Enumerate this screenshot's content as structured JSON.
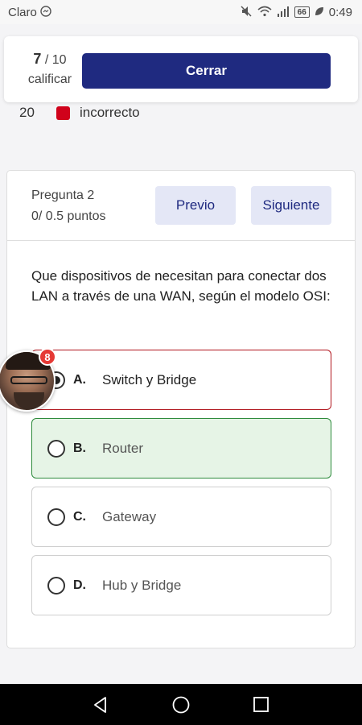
{
  "status_bar": {
    "carrier": "Claro",
    "battery": "66",
    "time": "0:49",
    "icons": [
      "messenger-icon",
      "mute-icon",
      "wifi-icon",
      "signal-icon",
      "battery-icon",
      "leaf-icon"
    ]
  },
  "progress": {
    "current": "7",
    "separator": "/",
    "total": "10",
    "grade_label": "calificar"
  },
  "close_button": {
    "label": "Cerrar"
  },
  "legend": {
    "count": "20",
    "label": "incorrecto",
    "color": "#d0021b"
  },
  "question": {
    "number_label": "Pregunta 2",
    "points": "0/ 0.5 puntos",
    "prev_label": "Previo",
    "next_label": "Siguiente",
    "text": "Que dispositivos de necesitan para conectar dos LAN a través de una WAN, según el modelo OSI:",
    "options": [
      {
        "letter": "A.",
        "text": "Switch y Bridge",
        "state": "selected-incorrect"
      },
      {
        "letter": "B.",
        "text": "Router",
        "state": "correct"
      },
      {
        "letter": "C.",
        "text": "Gateway",
        "state": "neutral"
      },
      {
        "letter": "D.",
        "text": "Hub y Bridge",
        "state": "neutral"
      }
    ]
  },
  "chat_head": {
    "badge": "8"
  },
  "colors": {
    "accent": "#1f2a80",
    "incorrect": "#b0141c",
    "correct_bg": "#e6f4e6",
    "correct_border": "#2e8b3c"
  }
}
